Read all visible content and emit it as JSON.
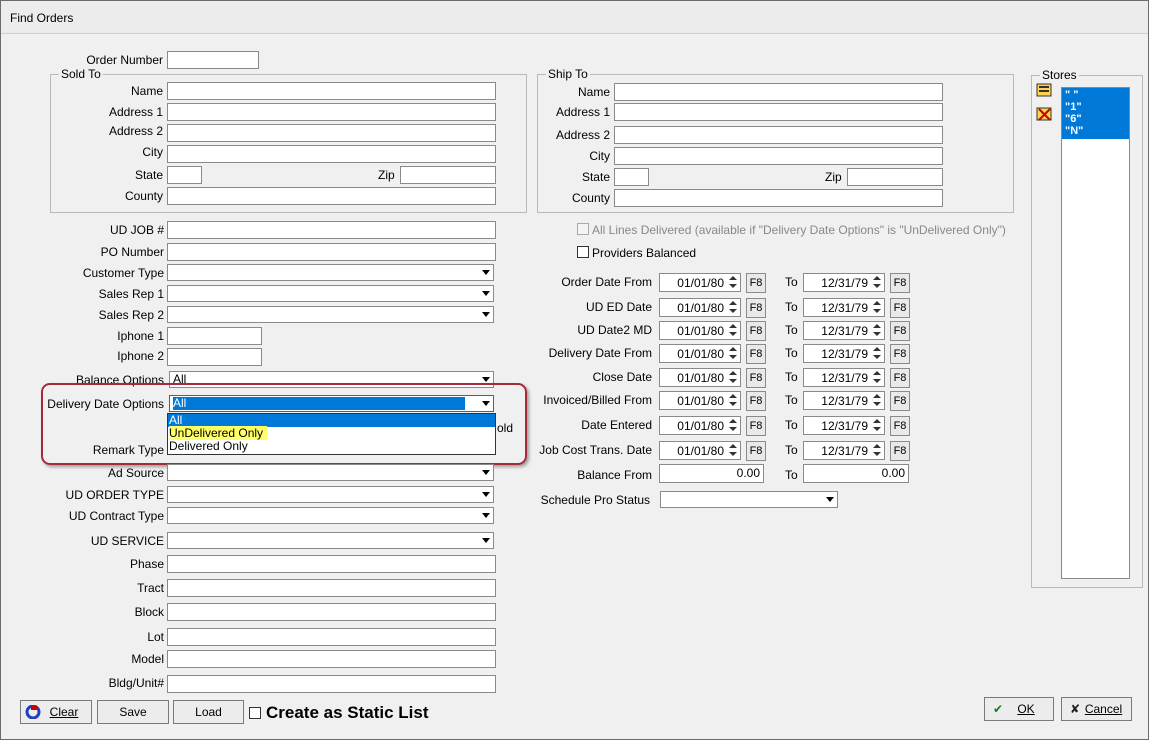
{
  "window": {
    "title": "Find Orders"
  },
  "labels": {
    "order_number": "Order Number",
    "sold_to": "Sold To",
    "ship_to": "Ship To",
    "name": "Name",
    "address1": "Address 1",
    "address2": "Address 2",
    "city": "City",
    "state": "State",
    "zip": "Zip",
    "county": "County",
    "ud_job": "UD JOB #",
    "po_number": "PO Number",
    "customer_type": "Customer Type",
    "sales_rep1": "Sales Rep 1",
    "sales_rep2": "Sales Rep 2",
    "iphone1": "Iphone 1",
    "iphone2": "Iphone 2",
    "balance_options": "Balance Options",
    "delivery_date_options": "Delivery Date Options",
    "hold_suffix": "old",
    "remark_type": "Remark Type",
    "ad_source": "Ad Source",
    "ud_order_type": "UD ORDER TYPE",
    "ud_contract_type": "UD Contract Type",
    "ud_service": "UD SERVICE",
    "phase": "Phase",
    "tract": "Tract",
    "block": "Block",
    "lot": "Lot",
    "model": "Model",
    "bldg_unit": "Bldg/Unit#",
    "all_lines_delivered": "All Lines Delivered (available if \"Delivery Date Options\" is \"UnDelivered Only\")",
    "providers_balanced": "Providers Balanced",
    "to": "To",
    "balance_from": "Balance From",
    "schedule_pro_status": "Schedule Pro Status",
    "stores": "Stores",
    "create_static_list": "Create as Static List"
  },
  "values": {
    "balance_options": "All",
    "delivery_date_options": "All"
  },
  "dropdown": {
    "options": [
      "All",
      "UnDelivered Only",
      "Delivered Only"
    ]
  },
  "date_rows": [
    {
      "label": "Order Date From",
      "from": "01/01/80",
      "to": "12/31/79"
    },
    {
      "label": "UD ED Date",
      "from": "01/01/80",
      "to": "12/31/79"
    },
    {
      "label": "UD Date2 MD",
      "from": "01/01/80",
      "to": "12/31/79"
    },
    {
      "label": "Delivery Date From",
      "from": "01/01/80",
      "to": "12/31/79"
    },
    {
      "label": "Close Date",
      "from": "01/01/80",
      "to": "12/31/79"
    },
    {
      "label": "Invoiced/Billed From",
      "from": "01/01/80",
      "to": "12/31/79"
    },
    {
      "label": "Date Entered",
      "from": "01/01/80",
      "to": "12/31/79"
    },
    {
      "label": "Job Cost Trans. Date",
      "from": "01/01/80",
      "to": "12/31/79"
    }
  ],
  "f8_label": "F8",
  "balance": {
    "from": "0.00",
    "to": "0.00"
  },
  "stores": [
    "\" \"",
    "\"1\"",
    "\"6\"",
    "\"N\""
  ],
  "buttons": {
    "clear": "Clear",
    "save": "Save",
    "load": "Load",
    "ok": "OK",
    "cancel": "Cancel"
  },
  "colors": {
    "selection_blue": "#0078d7",
    "highlight_yellow": "#ffff66",
    "callout_red": "#a52a3a"
  }
}
